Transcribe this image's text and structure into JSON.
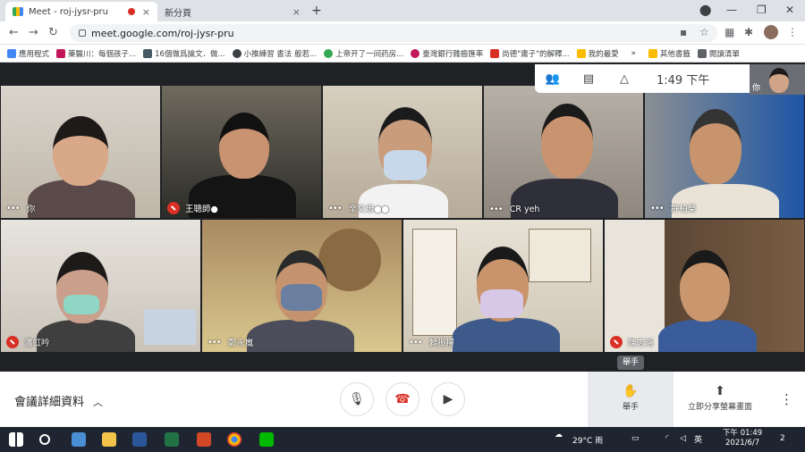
{
  "browser": {
    "tabs": [
      {
        "title": "Meet - roj-jysr-pru",
        "close": "×"
      },
      {
        "title": "新分頁",
        "close": "×"
      }
    ],
    "new_tab": "+",
    "controls": {
      "minimize": "—",
      "restore": "❐",
      "close": "✕",
      "profile": "⬤"
    },
    "nav": {
      "back": "←",
      "forward": "→",
      "reload": "↻"
    },
    "url": "meet.google.com/roj-jysr-pru",
    "bookmarks": [
      {
        "label": "應用程式",
        "color": "#4285f4"
      },
      {
        "label": "藥醫川：每個孩子...",
        "color": "#c2185b"
      },
      {
        "label": "16個做爲論文．做...",
        "color": "#455a64"
      },
      {
        "label": "小推練習 書法 般若...",
        "color": "#3c4043"
      },
      {
        "label": "上帝开了一间药房...",
        "color": "#34a853"
      },
      {
        "label": "臺灣銀行雜齒匯率",
        "color": "#c2185b"
      },
      {
        "label": "尚德\"庸子\"的解釋...",
        "color": "#d93025"
      },
      {
        "label": "我的最愛",
        "color": "#fbbc04"
      }
    ],
    "bookmarks_more": "»",
    "bookmarks_right": [
      {
        "label": "其他書籤",
        "color": "#fbbc04"
      },
      {
        "label": "閱讀清單",
        "color": "#5f6368"
      }
    ]
  },
  "meet": {
    "time": "1:49 下午",
    "self_label": "你",
    "participants": [
      {
        "name": "你",
        "muted": false
      },
      {
        "name": "王聰師●",
        "muted": true
      },
      {
        "name": "辛文忠●●",
        "muted": false
      },
      {
        "name": "CR yeh",
        "muted": false
      },
      {
        "name": "許柏榮",
        "muted": false
      },
      {
        "name": "潘虹吟",
        "muted": true
      },
      {
        "name": "鄭永嵐",
        "muted": false
      },
      {
        "name": "賴振權",
        "muted": false
      },
      {
        "name": "陳志鴻",
        "muted": true
      }
    ],
    "tooltip": "舉手",
    "details_label": "會議詳細資料",
    "raise_hand_label": "舉手",
    "share_label": "立即分享螢幕畫面"
  },
  "taskbar": {
    "weather": "29°C 雨",
    "ime": "英",
    "clock_time": "下午 01:49",
    "clock_date": "2021/6/7",
    "notifications": "2"
  }
}
